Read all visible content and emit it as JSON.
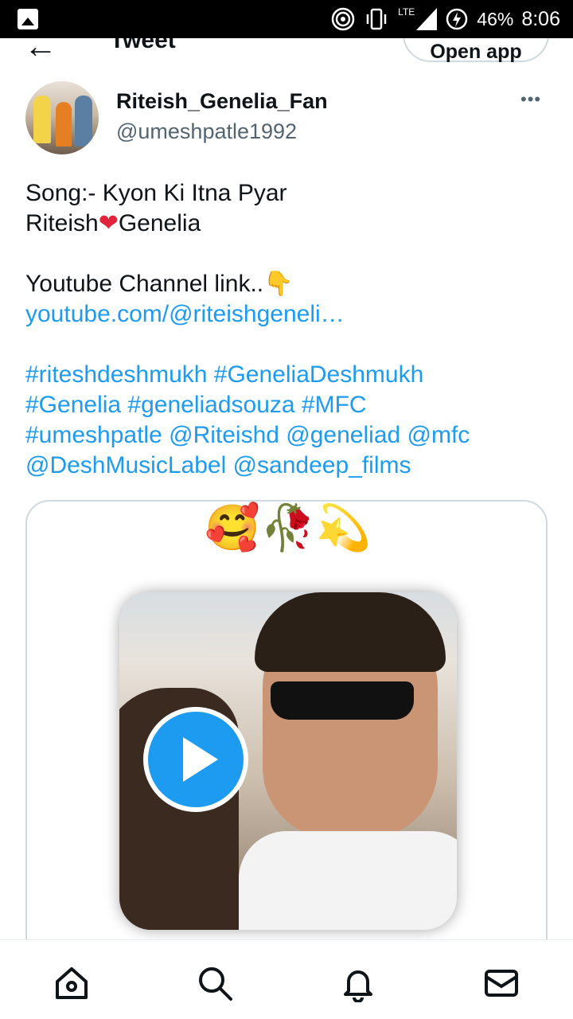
{
  "status_bar": {
    "lte": "LTE",
    "battery": "46%",
    "time": "8:06"
  },
  "header": {
    "title": "Tweet",
    "open_app": "Open app"
  },
  "tweet": {
    "display_name": "Riteish_Genelia_Fan",
    "handle": "@umeshpatle1992",
    "line1": "Song:- Kyon Ki Itna Pyar",
    "line2_a": "Riteish",
    "line2_heart": "❤",
    "line2_b": "Genelia",
    "line3": "Youtube Channel link..",
    "line3_emoji": "👇",
    "link": "youtube.com/@riteishgeneli…",
    "tags_line1": "#riteshdeshmukh #GeneliaDeshmukh",
    "tags_line2": "#Genelia #geneliadsouza #MFC",
    "tags_line3": "#umeshpatle @Riteishd @geneliad @mfc",
    "tags_line4": "@DeshMusicLabel @sandeep_films",
    "media_emojis": "🥰🥀💫"
  },
  "colors": {
    "accent": "#1d9bf0",
    "text": "#0f1419",
    "secondary": "#536471"
  },
  "nav": [
    "home-icon",
    "search-icon",
    "notifications-icon",
    "messages-icon"
  ]
}
